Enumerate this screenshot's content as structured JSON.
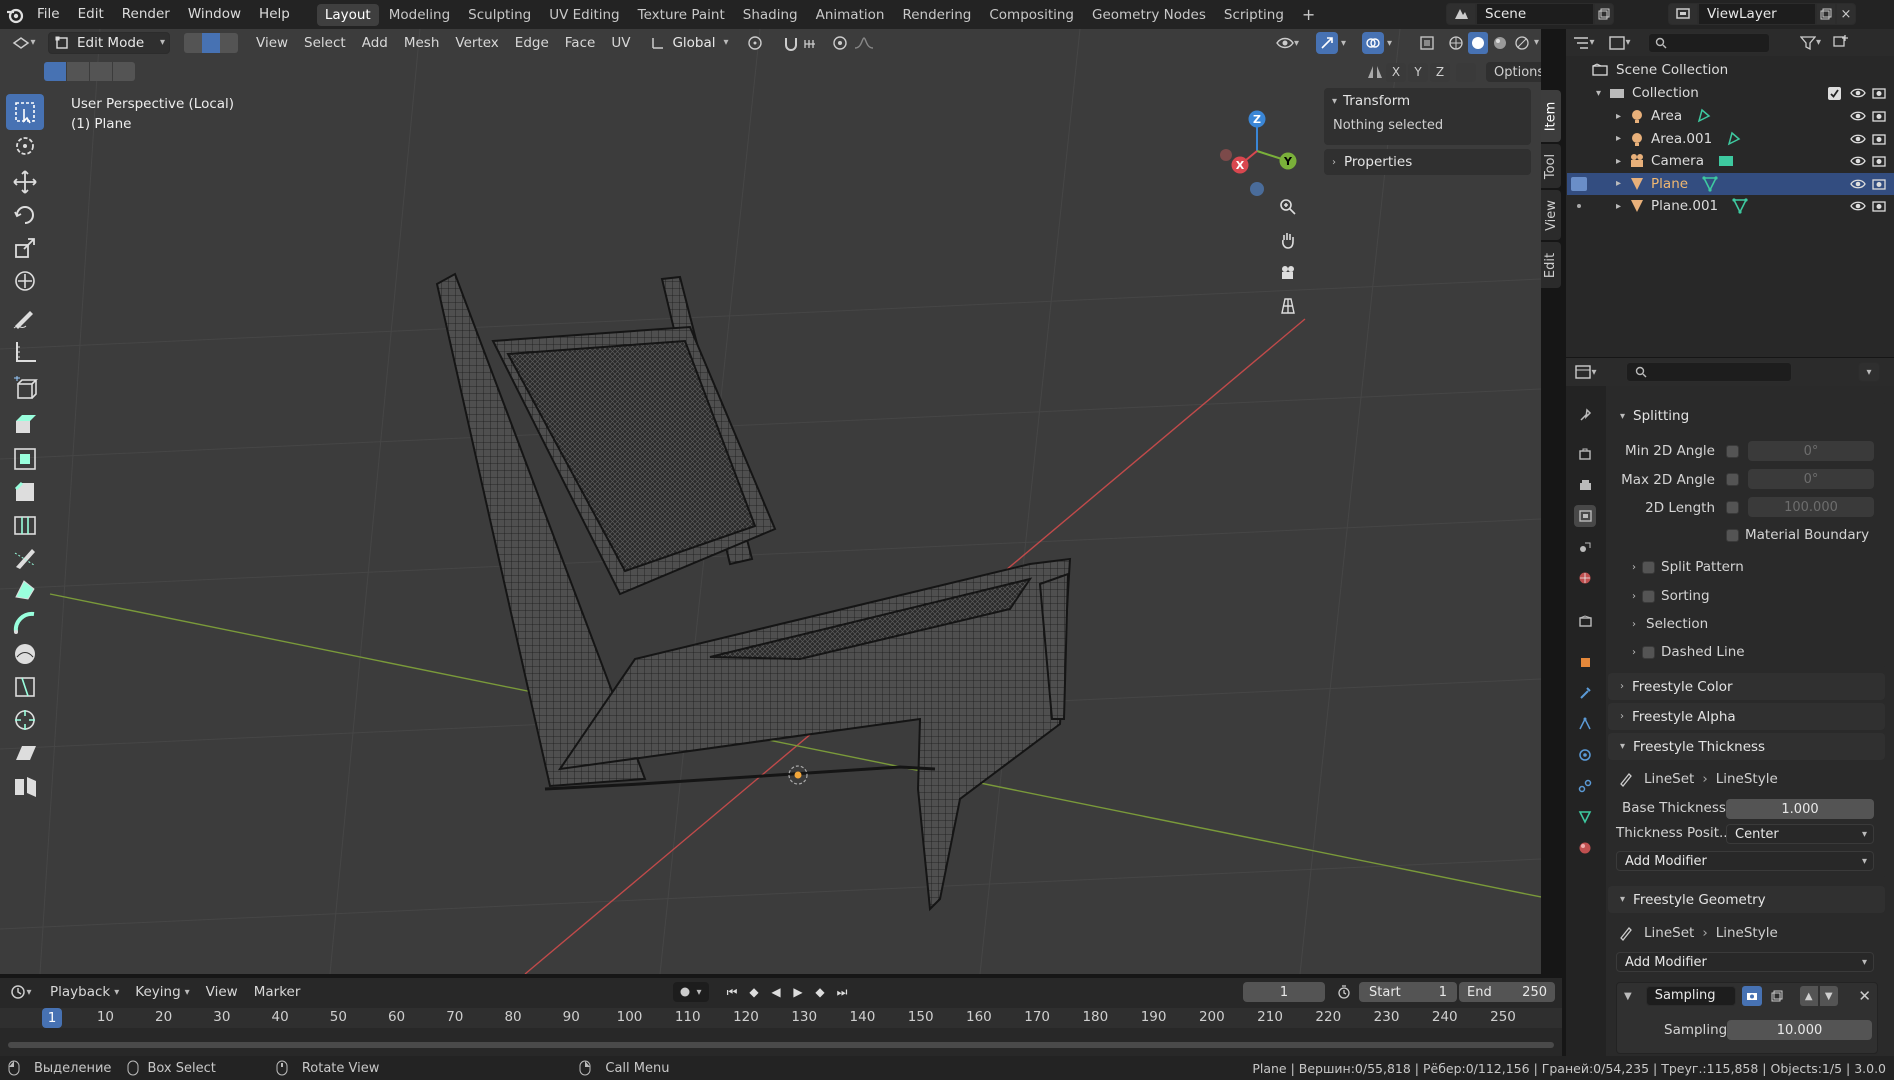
{
  "app": {
    "name": "Blender",
    "version": "3.0.0"
  },
  "topbar": {
    "menus": [
      "File",
      "Edit",
      "Render",
      "Window",
      "Help"
    ],
    "workspaces": [
      "Layout",
      "Modeling",
      "Sculpting",
      "UV Editing",
      "Texture Paint",
      "Shading",
      "Animation",
      "Rendering",
      "Compositing",
      "Geometry Nodes",
      "Scripting"
    ],
    "active_workspace": "Layout",
    "scene_name": "Scene",
    "view_layer": "ViewLayer",
    "add_workspace": "+"
  },
  "viewport": {
    "mode": "Edit Mode",
    "menus": [
      "View",
      "Select",
      "Add",
      "Mesh",
      "Vertex",
      "Edge",
      "Face",
      "UV"
    ],
    "orientation": "Global",
    "overlay_title": "User Perspective (Local)",
    "overlay_subtitle": "(1) Plane",
    "axis_labels": {
      "x": "X",
      "y": "Y",
      "z": "Z"
    },
    "mirror_axes": [
      "X",
      "Y",
      "Z"
    ],
    "options_label": "Options",
    "npanel": {
      "transform_title": "Transform",
      "transform_status": "Nothing selected",
      "properties_title": "Properties",
      "tabs": [
        "Item",
        "Tool",
        "View",
        "Edit"
      ]
    },
    "toolbar_tools": [
      "select-box-tool",
      "cursor-tool",
      "move-tool",
      "rotate-tool",
      "scale-tool",
      "transform-tool",
      "annotate-tool",
      "measure-tool",
      "add-cube-tool",
      "extrude-tool",
      "inset-tool",
      "bevel-tool",
      "loop-cut-tool",
      "knife-tool",
      "poly-build-tool",
      "spin-tool",
      "smooth-tool",
      "edge-slide-tool",
      "shrink-fatten-tool",
      "shear-tool",
      "rip-tool"
    ],
    "colors": {
      "background": "#3c3c3c",
      "grid": "#464646",
      "x_axis": "#c04a4a",
      "y_axis": "#7a9a3a",
      "active": "#4772b3"
    }
  },
  "outliner": {
    "root": "Scene Collection",
    "collection": "Collection",
    "items": [
      {
        "name": "Area",
        "type": "light",
        "selected": false
      },
      {
        "name": "Area.001",
        "type": "light",
        "selected": false
      },
      {
        "name": "Camera",
        "type": "camera",
        "selected": false
      },
      {
        "name": "Plane",
        "type": "mesh",
        "selected": true
      },
      {
        "name": "Plane.001",
        "type": "mesh",
        "selected": false
      }
    ]
  },
  "properties": {
    "splitting": {
      "title": "Splitting",
      "min_2d_angle": {
        "label": "Min 2D Angle",
        "value": "0°"
      },
      "max_2d_angle": {
        "label": "Max 2D Angle",
        "value": "0°"
      },
      "length_2d": {
        "label": "2D Length",
        "value": "100.000"
      },
      "material_boundary": "Material Boundary"
    },
    "sub_panels": [
      "Split Pattern",
      "Sorting",
      "Selection",
      "Dashed Line"
    ],
    "freestyle_color": "Freestyle Color",
    "freestyle_alpha": "Freestyle Alpha",
    "thickness": {
      "title": "Freestyle Thickness",
      "lineset": "LineSet",
      "linestyle": "LineStyle",
      "base_label": "Base Thickness",
      "base_value": "1.000",
      "position_label": "Thickness Posit...",
      "position_value": "Center",
      "add_modifier": "Add Modifier"
    },
    "geometry": {
      "title": "Freestyle Geometry",
      "lineset": "LineSet",
      "linestyle": "LineStyle",
      "add_modifier": "Add Modifier",
      "modifier_name": "Sampling",
      "sampling_label": "Sampling",
      "sampling_value": "10.000"
    }
  },
  "timeline": {
    "menus": [
      "Playback",
      "Keying",
      "View",
      "Marker"
    ],
    "current_frame": "1",
    "start_label": "Start",
    "start": "1",
    "end_label": "End",
    "end": "250",
    "ruler": [
      "1",
      "10",
      "20",
      "30",
      "40",
      "50",
      "60",
      "70",
      "80",
      "90",
      "100",
      "110",
      "120",
      "130",
      "140",
      "150",
      "160",
      "170",
      "180",
      "190",
      "200",
      "210",
      "220",
      "230",
      "240",
      "250"
    ]
  },
  "statusbar": {
    "left": [
      "Выделение",
      "Box Select",
      "Rotate View",
      "Call Menu"
    ],
    "stats": "Plane | Вершин:0/55,818 | Рёбер:0/112,156 | Граней:0/54,235 | Треуг.:115,858 | Objects:1/5 | 3.0.0"
  }
}
